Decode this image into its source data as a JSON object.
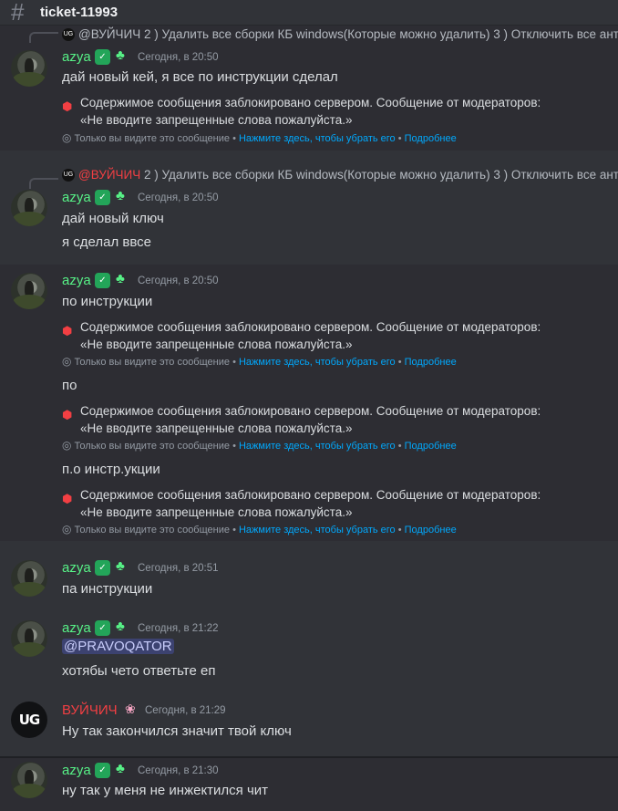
{
  "header": {
    "channel": "ticket-11993"
  },
  "reply_1": {
    "text": "@ВУЙЧИЧ 2 ) Удалить все сборки КБ windows(Которые можно удалить) 3 ) Отключить все анти"
  },
  "msg_1": {
    "author": "azya",
    "time": "Сегодня, в 20:50",
    "text": "дай новый кей, я все по инструкции сделал",
    "blocked_l1": "Содержимое сообщения заблокировано сервером. Сообщение от модераторов:",
    "blocked_l2": "«Не вводите запрещенные слова пожалуйста.»"
  },
  "ephemeral": {
    "only_you": "Только вы видите это сообщение",
    "dot": "•",
    "dismiss": "Нажмите здесь, чтобы убрать его",
    "more": "Подробнее"
  },
  "reply_2": {
    "author": "@ВУЙЧИЧ",
    "text": "2 ) Удалить все сборки КБ windows(Которые можно удалить) 3 ) Отключить все анти"
  },
  "msg_2": {
    "author": "azya",
    "time": "Сегодня, в 20:50",
    "text1": "дай новый ключ",
    "text2": "я сделал ввсе"
  },
  "msg_3": {
    "author": "azya",
    "time": "Сегодня, в 20:50",
    "text1": "по инструкции",
    "text2": "по",
    "text3": "п.о инстр.укции"
  },
  "msg_4": {
    "author": "azya",
    "time": "Сегодня, в 20:51",
    "text": "па инструкции"
  },
  "msg_5": {
    "author": "azya",
    "time": "Сегодня, в 21:22",
    "mention": "@PRAVOQATOR",
    "text": "хотябы чето ответьте еп"
  },
  "msg_6": {
    "author": "ВУЙЧИЧ",
    "avatar": "UG",
    "time": "Сегодня, в 21:29",
    "text": "Ну так закончился значит твой ключ"
  },
  "msg_7": {
    "author": "azya",
    "time": "Сегодня, в 21:30",
    "text": "ну так у меня не инжектился чит"
  }
}
